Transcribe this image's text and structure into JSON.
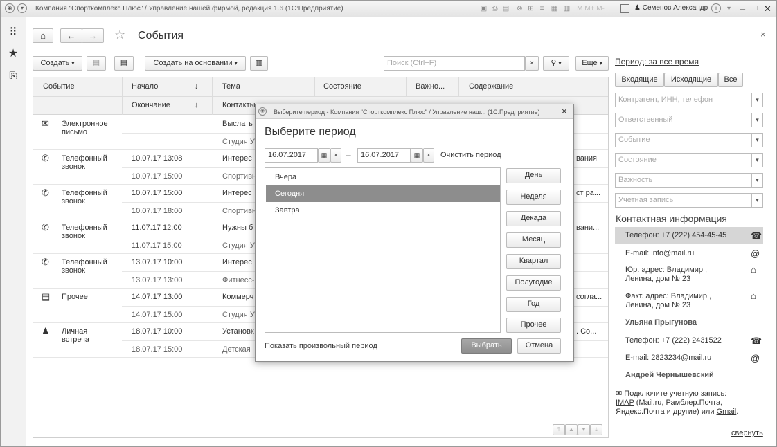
{
  "window": {
    "title": "Компания \"Спорткомплекс Плюс\" / Управление нашей фирмой, редакция 1.6  (1С:Предприятие)",
    "user": "Семенов Александр"
  },
  "nav": {
    "home_icon": "home-icon",
    "back_icon": "arrow-left-icon",
    "forward_icon": "arrow-right-icon",
    "star_icon": "star-icon",
    "page_title": "События",
    "close": "×"
  },
  "toolbar": {
    "create": "Создать",
    "create_based": "Создать на основании",
    "search_placeholder": "Поиск (Ctrl+F)",
    "more": "Еще",
    "clear": "×",
    "search_glass": "Q"
  },
  "table": {
    "headers_top": [
      "Событие",
      "Начало",
      "Тема",
      "Состояние",
      "Важно...",
      "Содержание"
    ],
    "headers_bottom": [
      "",
      "Окончание",
      "Контакты"
    ],
    "sort_arrow": "↓",
    "rows": [
      {
        "icon": "email-icon",
        "event": "Электронное письмо",
        "start": "",
        "end": "",
        "theme": "Выслать",
        "contacts": "Студия У",
        "content": ""
      },
      {
        "icon": "phone-icon",
        "event": "Телефонный звонок",
        "start": "10.07.17 13:08",
        "end": "10.07.17 15:00",
        "theme": "Интерес",
        "contacts": "Спортивн",
        "content": "вания"
      },
      {
        "icon": "phone-icon",
        "event": "Телефонный звонок",
        "start": "10.07.17 15:00",
        "end": "10.07.17 18:00",
        "theme": "Интерес",
        "contacts": "Спортивн",
        "content": "ст ра..."
      },
      {
        "icon": "phone-icon",
        "event": "Телефонный звонок",
        "start": "11.07.17 12:00",
        "end": "11.07.17 15:00",
        "theme": "Нужны б",
        "contacts": "Студия У",
        "content": "вани..."
      },
      {
        "icon": "phone-icon",
        "event": "Телефонный звонок",
        "start": "13.07.17 10:00",
        "end": "13.07.17 13:00",
        "theme": "Интерес",
        "contacts": "Фитнесс-",
        "content": ""
      },
      {
        "icon": "document-icon",
        "event": "Прочее",
        "start": "14.07.17 13:00",
        "end": "14.07.17 15:00",
        "theme": "Коммерч",
        "contacts": "Студия У",
        "content": "согла..."
      },
      {
        "icon": "person-icon",
        "event": "Личная встреча",
        "start": "18.07.17 10:00",
        "end": "18.07.17 15:00",
        "theme": "Установк",
        "contacts": "Детская",
        "content": ". Со..."
      }
    ]
  },
  "right_panel": {
    "period_link": "Период: за все время",
    "segments": [
      "Входящие",
      "Исходящие",
      "Все"
    ],
    "filters": [
      "Контрагент, ИНН, телефон",
      "Ответственный",
      "Событие",
      "Состояние",
      "Важность",
      "Учетная запись"
    ],
    "contact_title": "Контактная информация",
    "contacts": [
      {
        "text": "Телефон: +7 (222) 454-45-45",
        "icon": "☎",
        "selected": true
      },
      {
        "text": "E-mail: info@mail.ru",
        "icon": "@"
      },
      {
        "text": "Юр. адрес: Владимир , Ленина, дом № 23",
        "icon": "⌂"
      },
      {
        "text": "Факт. адрес: Владимир , Ленина, дом № 23",
        "icon": "⌂"
      }
    ],
    "person1": "Ульяна Прыгунова",
    "person1_contacts": [
      {
        "text": "Телефон: +7 (222) 2431522",
        "icon": "☎"
      },
      {
        "text": "E-mail: 2823234@mail.ru",
        "icon": "@"
      }
    ],
    "person2": "Андрей Чернышевский",
    "connect_text_1": "Подключите учетную запись:",
    "imap": "IMAP",
    "connect_text_2": " (Mail.ru, Рамблер.Почта, Яндекс.Почта и другие) или ",
    "gmail": "Gmail",
    "collapse": "свернуть"
  },
  "dialog": {
    "title": "Выберите период - Компания \"Спорткомплекс Плюс\" / Управление наш...  (1С:Предприятие)",
    "heading": "Выберите период",
    "date_from": "16.07.2017",
    "date_to": "16.07.2017",
    "dash": "–",
    "clear_period": "Очистить период",
    "list": [
      "Вчера",
      "Сегодня",
      "Завтра"
    ],
    "selected_index": 1,
    "period_buttons": [
      "День",
      "Неделя",
      "Декада",
      "Месяц",
      "Квартал",
      "Полугодие",
      "Год",
      "Прочее"
    ],
    "show_custom": "Показать произвольный период",
    "select": "Выбрать",
    "cancel": "Отмена",
    "close": "×"
  }
}
